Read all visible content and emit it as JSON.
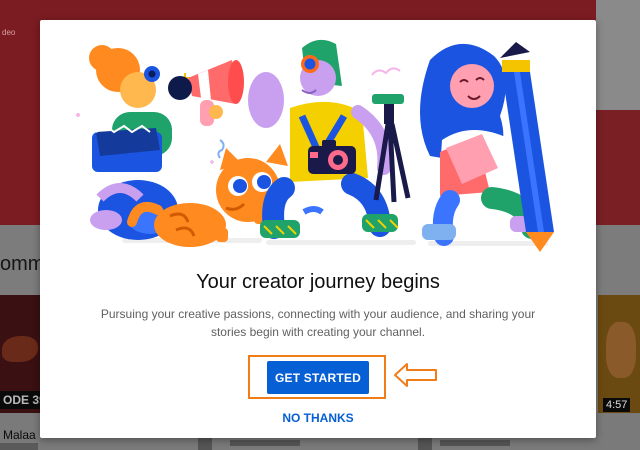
{
  "background": {
    "section_heading": "omme",
    "corner_text": "deo",
    "video_left": {
      "badge": "ODE 39",
      "caption": "Malaa"
    },
    "video_right": {
      "duration": "4:57"
    }
  },
  "dialog": {
    "title": "Your creator journey begins",
    "body": "Pursuing your creative passions, connecting with your audience, and sharing your stories begin with creating your channel.",
    "primary_label": "GET STARTED",
    "secondary_label": "NO THANKS"
  },
  "colors": {
    "accent": "#065fd4",
    "highlight": "#f07d1a",
    "overlay": "#7a7a7a"
  },
  "icons": [
    "camera-icon",
    "megaphone-icon",
    "pencil-icon",
    "tripod-icon",
    "clapperboard-icon",
    "cat-icon",
    "arrow-left-icon"
  ]
}
